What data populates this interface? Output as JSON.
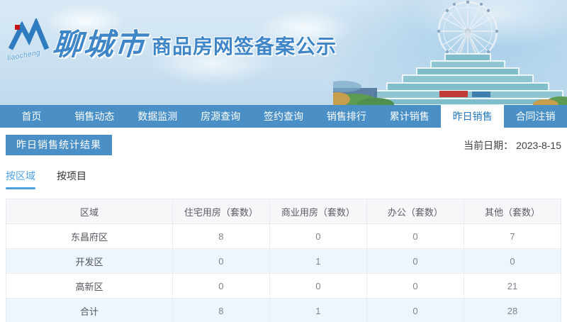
{
  "header": {
    "logo_script": "liaocheng",
    "city_name": "聊城市",
    "site_title": "商品房网签备案公示"
  },
  "nav": {
    "items": [
      {
        "label": "首页",
        "active": false
      },
      {
        "label": "销售动态",
        "active": false
      },
      {
        "label": "数据监测",
        "active": false
      },
      {
        "label": "房源查询",
        "active": false
      },
      {
        "label": "签约查询",
        "active": false
      },
      {
        "label": "销售排行",
        "active": false
      },
      {
        "label": "累计销售",
        "active": false
      },
      {
        "label": "昨日销售",
        "active": true
      },
      {
        "label": "合同注销",
        "active": false
      }
    ]
  },
  "page": {
    "section_title": "昨日销售统计结果",
    "date_label": "当前日期：",
    "date_value": "2023-8-15",
    "tabs": [
      {
        "label": "按区域",
        "active": true
      },
      {
        "label": "按项目",
        "active": false
      }
    ]
  },
  "table": {
    "columns": [
      "区域",
      "住宅用房（套数）",
      "商业用房（套数）",
      "办公（套数）",
      "其他（套数）"
    ],
    "rows": [
      {
        "region": "东昌府区",
        "values": [
          "8",
          "0",
          "0",
          "7"
        ]
      },
      {
        "region": "开发区",
        "values": [
          "0",
          "1",
          "0",
          "0"
        ]
      },
      {
        "region": "高新区",
        "values": [
          "0",
          "0",
          "0",
          "21"
        ]
      },
      {
        "region": "合计",
        "values": [
          "8",
          "1",
          "0",
          "28"
        ]
      }
    ]
  },
  "colors": {
    "nav_blue": "#4a90c6",
    "active_nav_text": "#2277c0",
    "brand_blue": "#3e86c8",
    "subtab_active": "#4da0e0",
    "table_header_bg": "#f7f7f9",
    "table_alt_row_bg": "#edf6fd",
    "table_border": "#e9ebee",
    "logo_red": "#c41414"
  },
  "icons": {
    "logo": "mountain-m-logo",
    "header_art": "ferris-wheel-building-photo"
  }
}
